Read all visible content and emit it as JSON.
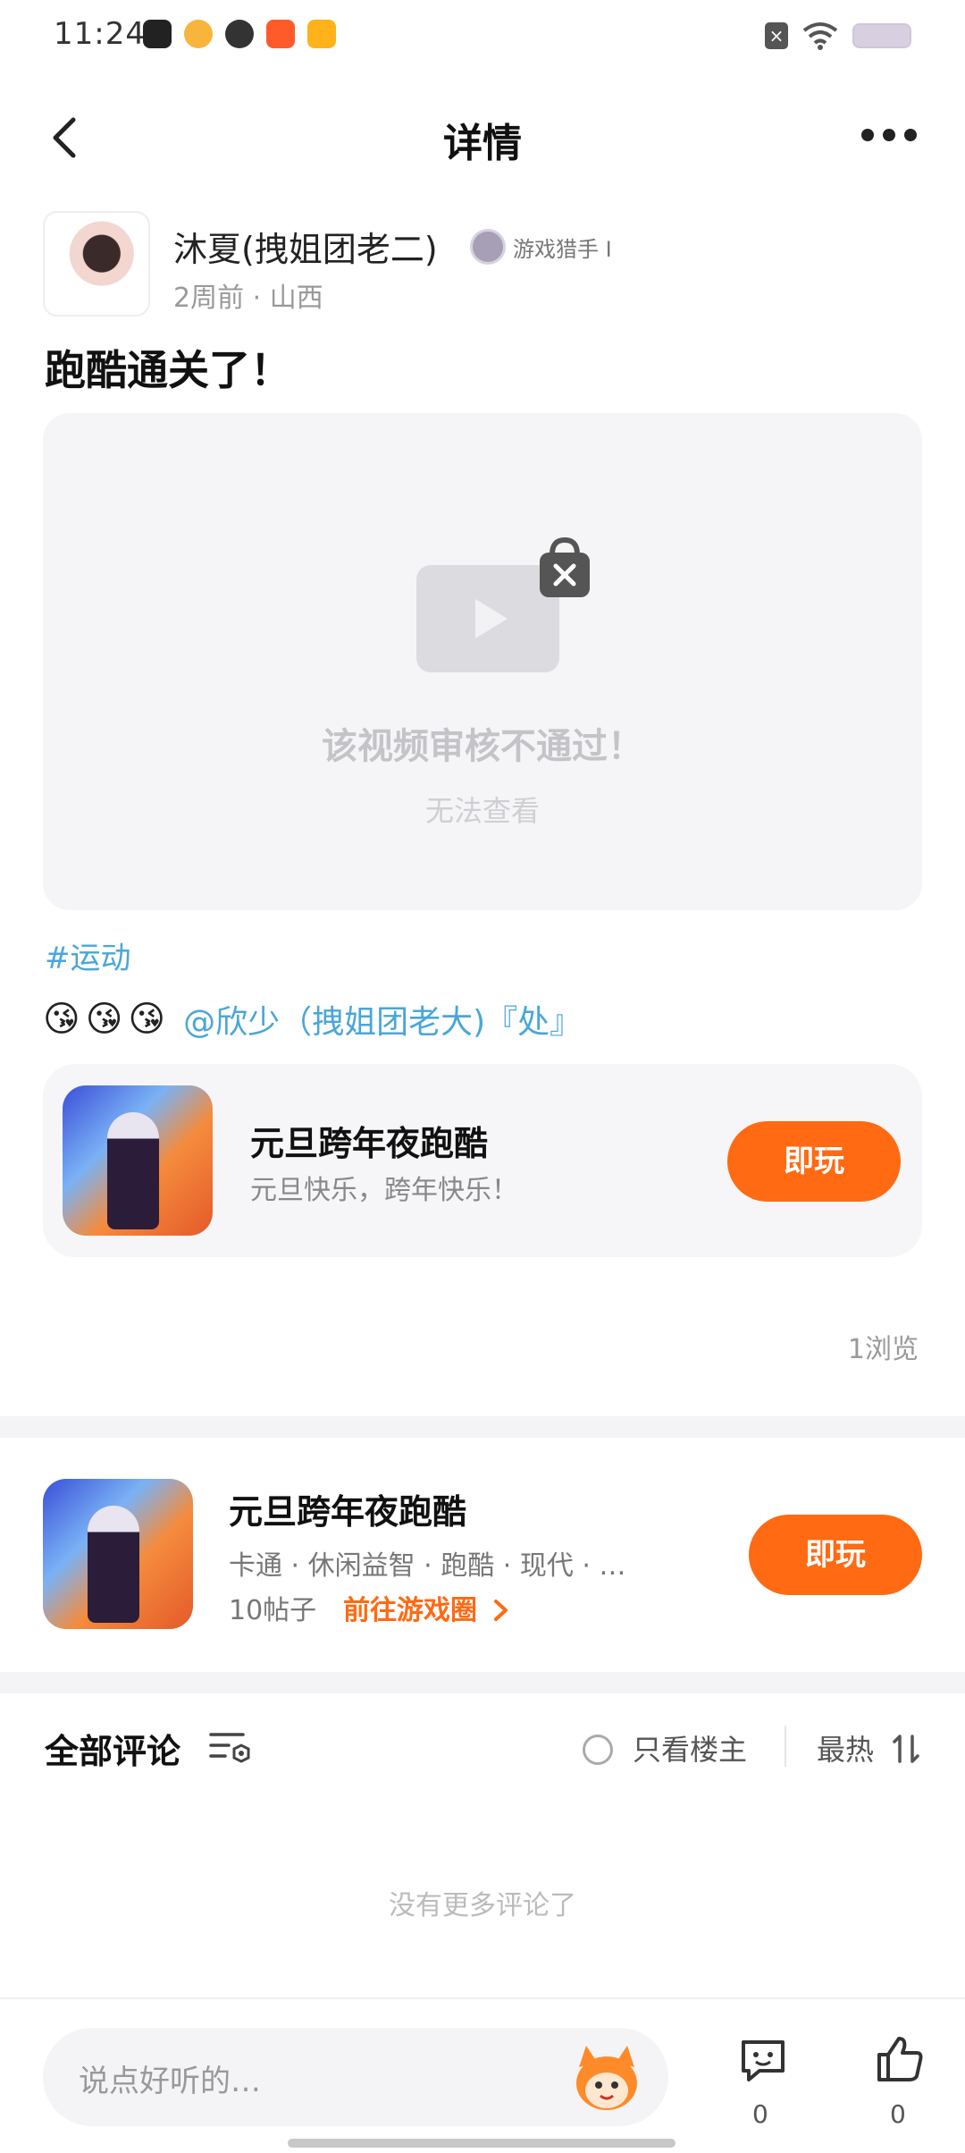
{
  "status_bar": {
    "time": "11:24",
    "app_colors": [
      "#222222",
      "#f7b53b",
      "#333333",
      "#ff5a2a",
      "#ffb21a"
    ]
  },
  "header": {
    "title": "详情",
    "back_icon": "chevron-left-icon",
    "more_icon": "more-dots-icon"
  },
  "post": {
    "author": {
      "name": "沐夏(拽姐团老二)",
      "badge": "游戏猎手 I",
      "meta": "2周前 · 山西"
    },
    "title": "跑酷通关了！",
    "video": {
      "message": "该视频审核不通过！",
      "sub": "无法查看"
    },
    "hashtag": "#运动",
    "emojis": [
      "😘",
      "😘",
      "😘"
    ],
    "mention": "@欣少（拽姐团老大)『处』",
    "game_card": {
      "name": "元旦跨年夜跑酷",
      "desc": "元旦快乐，跨年快乐！",
      "play_label": "即玩"
    },
    "views": "1浏览"
  },
  "game_section": {
    "name": "元旦跨年夜跑酷",
    "tags": "卡通 · 休闲益智 · 跑酷 · 现代 · …",
    "posts": "10帖子",
    "link": "前往游戏圈",
    "play_label": "即玩"
  },
  "comments": {
    "title": "全部评论",
    "owner_only": "只看楼主",
    "sort": "最热",
    "empty": "没有更多评论了"
  },
  "bottom": {
    "input_placeholder": "说点好听的…",
    "comment_count": "0",
    "like_count": "0"
  },
  "colors": {
    "accent": "#ff6a13",
    "link": "#4aa6d8"
  }
}
